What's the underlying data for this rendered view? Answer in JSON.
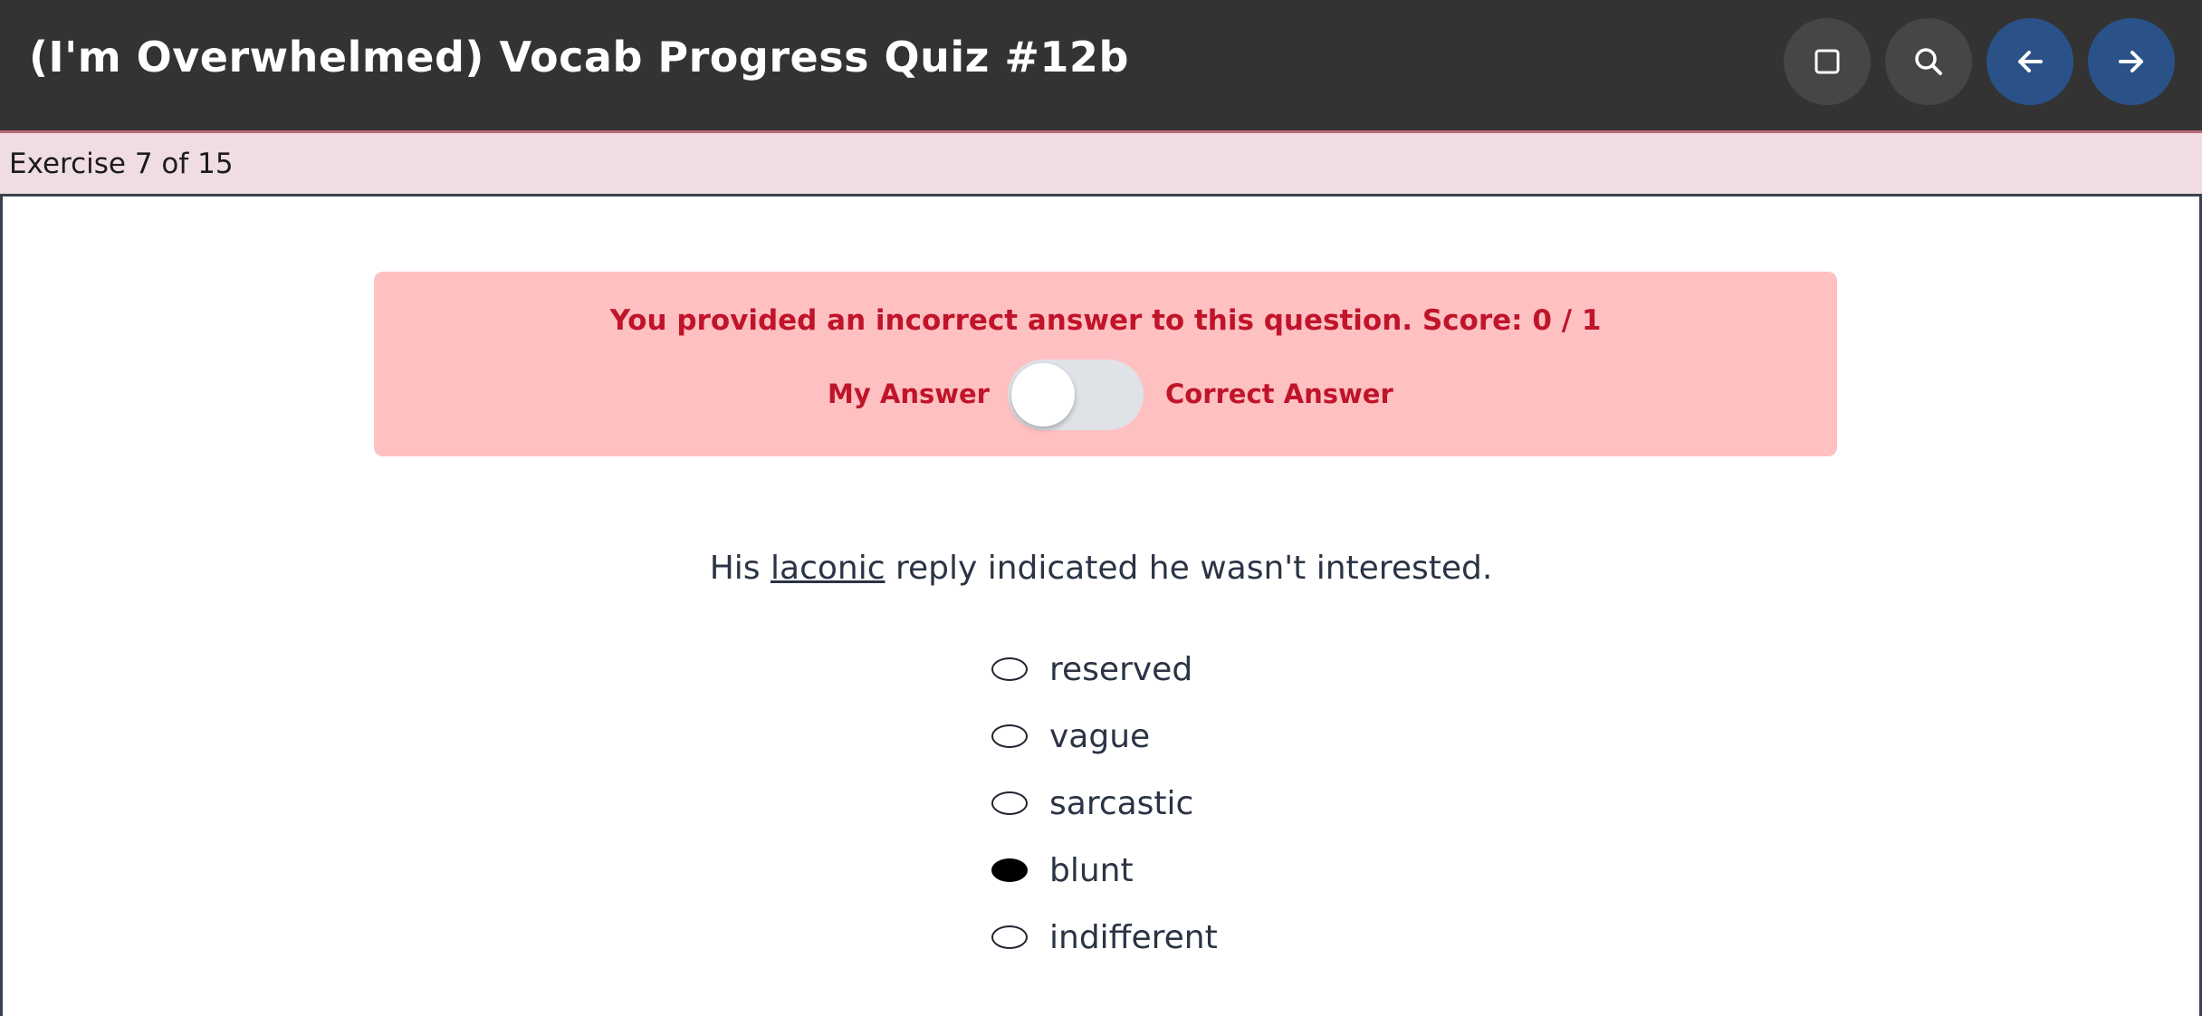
{
  "header": {
    "title": "(I'm Overwhelmed) Vocab Progress Quiz #12b",
    "buttons": [
      {
        "name": "fullscreen-button",
        "icon": "square-icon"
      },
      {
        "name": "search-button",
        "icon": "search-icon"
      },
      {
        "name": "previous-button",
        "icon": "arrow-left-icon"
      },
      {
        "name": "next-button",
        "icon": "arrow-right-icon"
      }
    ]
  },
  "progress": {
    "label": "Exercise 7 of 15"
  },
  "feedback": {
    "message": "You provided an incorrect answer to this question. Score: 0 / 1",
    "toggle_left_label": "My Answer",
    "toggle_right_label": "Correct Answer",
    "toggle_state": "my-answer"
  },
  "question": {
    "prefix": "His ",
    "term": "laconic",
    "suffix": " reply indicated he wasn't interested."
  },
  "options": [
    {
      "label": "reserved",
      "selected": false
    },
    {
      "label": "vague",
      "selected": false
    },
    {
      "label": "sarcastic",
      "selected": false
    },
    {
      "label": "blunt",
      "selected": true
    },
    {
      "label": "indifferent",
      "selected": false
    }
  ],
  "colors": {
    "header_bg": "#333333",
    "nav_button": "#2a5289",
    "feedback_bg": "#ffc0c2",
    "feedback_text": "#c0142a",
    "progress_bg": "#f0dde1"
  }
}
